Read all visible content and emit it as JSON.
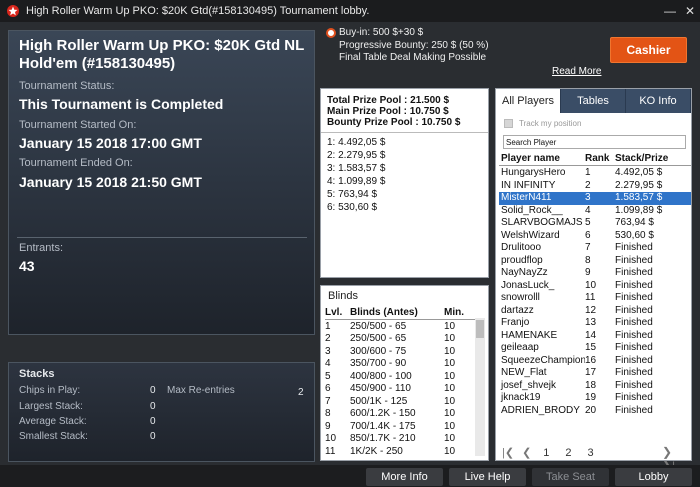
{
  "window": {
    "title": "High Roller Warm Up PKO: $20K Gtd(#158130495) Tournament lobby."
  },
  "tournament": {
    "name": "High Roller Warm Up PKO: $20K Gtd NL Hold'em (#158130495)",
    "status_label": "Tournament Status:",
    "status_value": "This Tournament is Completed",
    "started_label": "Tournament Started On:",
    "started_value": "January 15 2018  17:00 GMT",
    "ended_label": "Tournament Ended On:",
    "ended_value": "January 15 2018  21:50 GMT",
    "entrants_label": "Entrants:",
    "entrants_value": "43"
  },
  "stacks": {
    "header": "Stacks",
    "chips_label": "Chips in Play:",
    "chips_value": "0",
    "largest_label": "Largest Stack:",
    "largest_value": "0",
    "average_label": "Average Stack:",
    "average_value": "0",
    "smallest_label": "Smallest Stack:",
    "smallest_value": "0",
    "reentries_label": "Max Re-entries",
    "reentries_value": "2"
  },
  "info": {
    "buyin": "Buy-in: 500 $+30 $",
    "bounty": "Progressive Bounty: 250 $ (50 %)",
    "deal": "Final Table Deal Making Possible",
    "read_more": "Read More",
    "cashier": "Cashier"
  },
  "prize": {
    "total": "Total Prize Pool : 21.500 $",
    "main": "Main Prize Pool : 10.750 $",
    "bounty": "Bounty Prize Pool : 10.750 $",
    "places": [
      "1: 4.492,05 $",
      "2: 2.279,95 $",
      "3: 1.583,57 $",
      "4: 1.099,89 $",
      "5: 763,94 $",
      "6: 530,60 $"
    ]
  },
  "blinds": {
    "header": "Blinds",
    "col_lvl": "Lvl.",
    "col_blinds": "Blinds (Antes)",
    "col_min": "Min.",
    "rows": [
      [
        "1",
        "250/500 - 65",
        "10"
      ],
      [
        "2",
        "250/500 - 65",
        "10"
      ],
      [
        "3",
        "300/600 - 75",
        "10"
      ],
      [
        "4",
        "350/700 - 90",
        "10"
      ],
      [
        "5",
        "400/800 - 100",
        "10"
      ],
      [
        "6",
        "450/900 - 110",
        "10"
      ],
      [
        "7",
        "500/1K - 125",
        "10"
      ],
      [
        "8",
        "600/1.2K - 150",
        "10"
      ],
      [
        "9",
        "700/1.4K - 175",
        "10"
      ],
      [
        "10",
        "850/1.7K - 210",
        "10"
      ],
      [
        "11",
        "1K/2K - 250",
        "10"
      ]
    ]
  },
  "players": {
    "tabs": [
      "All Players",
      "Tables",
      "KO Info"
    ],
    "track_label": "Track my position",
    "search_placeholder": "Search Player",
    "col_name": "Player name",
    "col_rank": "Rank",
    "col_stack": "Stack/Prize",
    "rows": [
      [
        "HungarysHero",
        "1",
        "4.492,05 $"
      ],
      [
        "IN INFINITY",
        "2",
        "2.279,95 $"
      ],
      [
        "MisterN411",
        "3",
        "1.583,57 $"
      ],
      [
        "Solid_Rock__",
        "4",
        "1.099,89 $"
      ],
      [
        "SLARVBOGMAJS",
        "5",
        "763,94 $"
      ],
      [
        "WelshWizard",
        "6",
        "530,60 $"
      ],
      [
        "Drulitooo",
        "7",
        "Finished"
      ],
      [
        "proudflop",
        "8",
        "Finished"
      ],
      [
        "NayNayZz",
        "9",
        "Finished"
      ],
      [
        "JonasLuck_",
        "10",
        "Finished"
      ],
      [
        "snowrolll",
        "11",
        "Finished"
      ],
      [
        "dartazz",
        "12",
        "Finished"
      ],
      [
        "Franjo",
        "13",
        "Finished"
      ],
      [
        "HAMENAKE",
        "14",
        "Finished"
      ],
      [
        "geileaap",
        "15",
        "Finished"
      ],
      [
        "SqueezeChampion",
        "16",
        "Finished"
      ],
      [
        "NEW_Flat",
        "17",
        "Finished"
      ],
      [
        "josef_shvejk",
        "18",
        "Finished"
      ],
      [
        "jknack19",
        "19",
        "Finished"
      ],
      [
        "ADRIEN_BRODY",
        "20",
        "Finished"
      ]
    ],
    "pages": [
      "1",
      "2",
      "3"
    ]
  },
  "bottom": {
    "more_info": "More Info",
    "live_help": "Live Help",
    "take_seat": "Take Seat",
    "lobby": "Lobby"
  }
}
